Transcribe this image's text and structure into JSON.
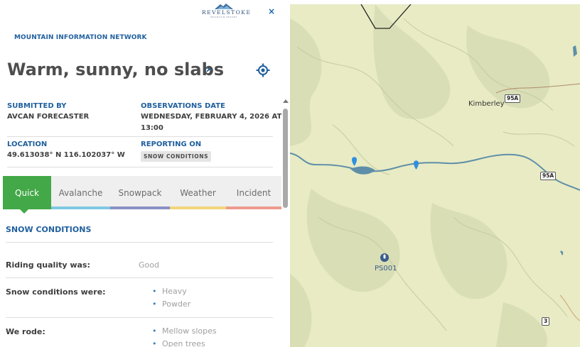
{
  "logo": {
    "name": "REVELSTOKE",
    "tagline": "MOUNTAIN RESORT"
  },
  "header": {
    "close_symbol": "×",
    "network_label": "MOUNTAIN INFORMATION NETWORK",
    "title": "Warm, sunny, no slabs",
    "title_chevron": "›"
  },
  "meta": {
    "submitted_by_label": "SUBMITTED BY",
    "submitted_by": "AVCAN FORECASTER",
    "obs_date_label": "OBSERVATIONS DATE",
    "obs_date_line1": "WEDNESDAY, FEBRUARY 4, 2026 AT",
    "obs_date_line2": "13:00",
    "location_label": "LOCATION",
    "location": "49.613038° N 116.102037° W",
    "reporting_label": "REPORTING ON",
    "reporting_chip": "SNOW CONDITIONS"
  },
  "tabs": [
    {
      "label": "Quick",
      "color": "#43a847",
      "active": true
    },
    {
      "label": "Avalanche",
      "color": "#7ec8e3",
      "active": false
    },
    {
      "label": "Snowpack",
      "color": "#8a8fc6",
      "active": false
    },
    {
      "label": "Weather",
      "color": "#f1d679",
      "active": false
    },
    {
      "label": "Incident",
      "color": "#ef9a8f",
      "active": false
    }
  ],
  "section": {
    "title": "SNOW CONDITIONS",
    "riding_quality_label": "Riding quality was:",
    "riding_quality_value": "Good",
    "snow_conditions_label": "Snow conditions were:",
    "snow_conditions": [
      "Heavy",
      "Powder"
    ],
    "we_rode_label": "We rode:",
    "we_rode": [
      "Mellow slopes",
      "Open trees"
    ]
  },
  "map": {
    "place_label": "Kimberley",
    "station_label": "PS001",
    "highway_labels": [
      "95A",
      "95A",
      "3"
    ],
    "colors": {
      "land": "#e8ebc4",
      "water": "#5f8fa8",
      "marker": "#2f8fe0",
      "station": "#3b5b8c"
    }
  }
}
